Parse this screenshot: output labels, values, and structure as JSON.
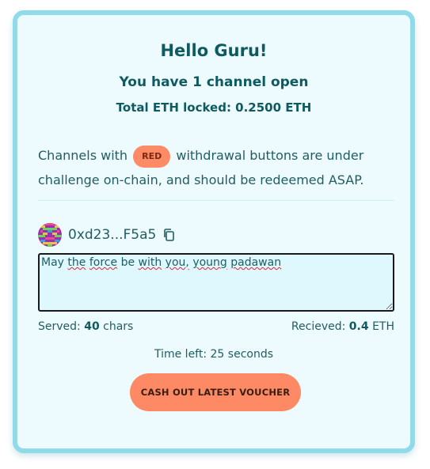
{
  "header": {
    "greeting": "Hello Guru!",
    "channels_open": "You have 1 channel open",
    "total_locked": "Total ETH locked: 0.2500 ETH"
  },
  "notice": {
    "before": "Channels with ",
    "badge": "RED",
    "after": " withdrawal buttons are under challenge on-chain, and should be redeemed ASAP."
  },
  "channel": {
    "address": "0xd23...F5a5",
    "message_words": [
      "May",
      "the",
      "force",
      "be",
      "with",
      "you,",
      "young",
      "padawan"
    ],
    "message_misspelled": [
      false,
      true,
      true,
      false,
      true,
      true,
      true,
      true
    ],
    "served_label": "Served:",
    "served_value": "40",
    "served_unit": "chars",
    "received_label": "Recieved:",
    "received_value": "0.4",
    "received_unit": "ETH",
    "time_left": "Time left: 25 seconds",
    "cashout_label": "CASH OUT LATEST VOUCHER"
  },
  "icons": {
    "avatar": "pixel-identicon",
    "copy": "copy-icon"
  },
  "colors": {
    "accent": "#fd8a64",
    "card_bg": "#eefbfe",
    "card_border": "#8fdbea",
    "text": "#0d5b60"
  }
}
